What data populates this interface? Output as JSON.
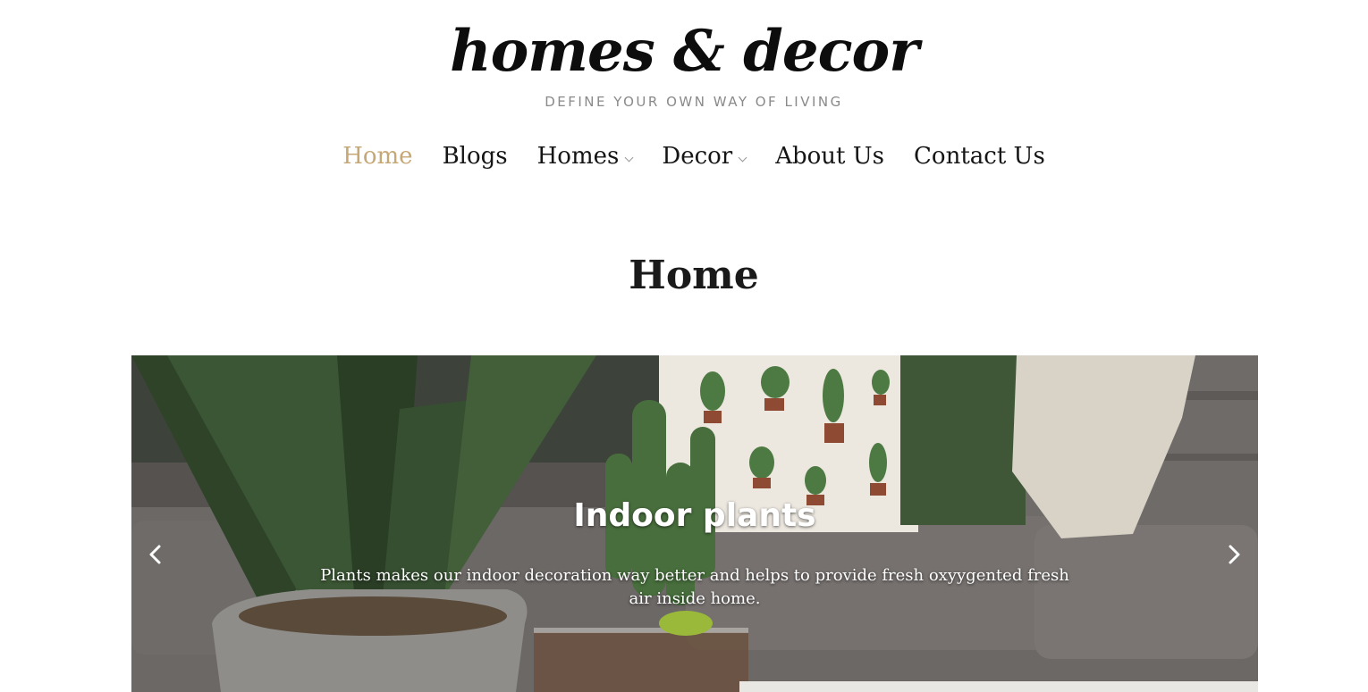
{
  "site": {
    "title": "homes & decor",
    "tagline": "DEFINE YOUR OWN WAY OF LIVING"
  },
  "nav": {
    "items": [
      {
        "label": "Home",
        "active": true,
        "has_dropdown": false
      },
      {
        "label": "Blogs",
        "active": false,
        "has_dropdown": false
      },
      {
        "label": "Homes",
        "active": false,
        "has_dropdown": true
      },
      {
        "label": "Decor",
        "active": false,
        "has_dropdown": true
      },
      {
        "label": "About Us",
        "active": false,
        "has_dropdown": false
      },
      {
        "label": "Contact Us",
        "active": false,
        "has_dropdown": false
      }
    ]
  },
  "page": {
    "title": "Home"
  },
  "slider": {
    "caption_title": "Indoor plants",
    "caption_text": "Plants makes our indoor decoration way better and helps to provide fresh oxyygented fresh air inside home.",
    "prev_icon": "chevron-left-icon",
    "next_icon": "chevron-right-icon"
  },
  "colors": {
    "accent": "#c6a776",
    "text": "#151515",
    "tagline": "#8a8a8a"
  }
}
